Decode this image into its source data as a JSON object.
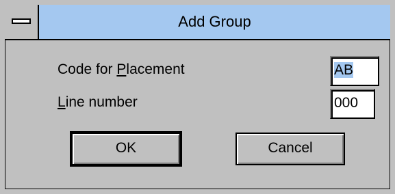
{
  "window": {
    "title": "Add Group"
  },
  "fields": {
    "placement": {
      "label_prefix": "Code for ",
      "label_mnemonic": "P",
      "label_suffix": "lacement",
      "value": "AB"
    },
    "line_number": {
      "label_mnemonic": "L",
      "label_suffix": "ine number",
      "value": "000"
    }
  },
  "buttons": {
    "ok_label": "OK",
    "cancel_label": "Cancel"
  },
  "colors": {
    "face": "#c0c0c0",
    "titlebar": "#a4c8f0",
    "selection": "#a4c8f0"
  }
}
